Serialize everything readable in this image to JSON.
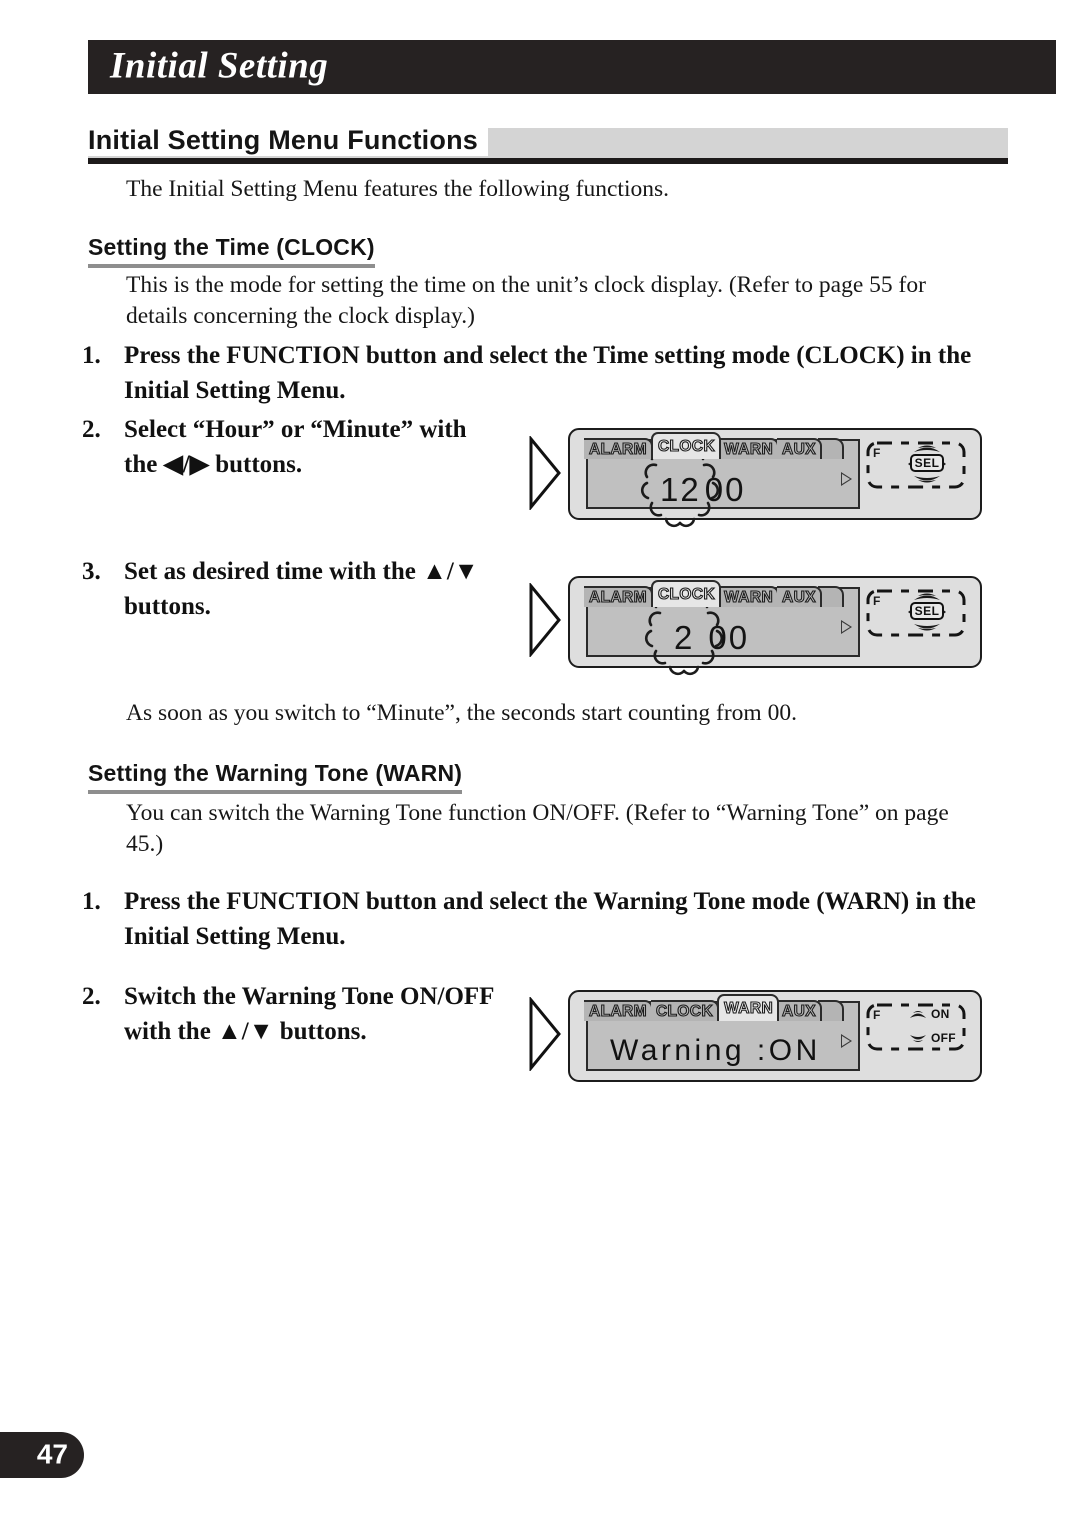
{
  "header": {
    "running_head": "Initial Setting"
  },
  "section": {
    "heading": "Initial Setting Menu Functions",
    "intro": "The Initial Setting Menu features the following functions."
  },
  "clock": {
    "subheading": "Setting the Time (CLOCK)",
    "description": "This is the mode for setting the time on the unit’s clock display. (Refer to page 55 for details concerning the clock display.)",
    "steps": [
      {
        "num": "1.",
        "text": "Press the FUNCTION button and select the Time setting mode (CLOCK) in the Initial Setting Menu."
      },
      {
        "num": "2.",
        "text": "Select “Hour” or “Minute” with the ◀/▶ buttons."
      },
      {
        "num": "3.",
        "text": "Set as desired time with the ▲/▼ buttons."
      }
    ],
    "note": "As soon as you switch to “Minute”, the seconds start counting from 00."
  },
  "warn": {
    "subheading": "Setting the Warning Tone (WARN)",
    "description": "You can switch the Warning Tone function ON/OFF. (Refer to “Warning Tone” on page 45.)",
    "steps": [
      {
        "num": "1.",
        "text": "Press the FUNCTION button and select the Warning Tone mode (WARN) in the Initial Setting Menu."
      },
      {
        "num": "2.",
        "text": "Switch the Warning Tone ON/OFF with the ▲/▼ buttons."
      }
    ]
  },
  "displays": [
    {
      "id": "clock-hour",
      "tabs": [
        "ALARM",
        "CLOCK",
        "WARN",
        "AUX"
      ],
      "active_tab": "CLOCK",
      "blinking_value": "12",
      "static_value": "00",
      "keys": {
        "func_label": "F",
        "select_label": "SEL"
      }
    },
    {
      "id": "clock-minute",
      "tabs": [
        "ALARM",
        "CLOCK",
        "WARN",
        "AUX"
      ],
      "active_tab": "CLOCK",
      "blinking_value": "2",
      "static_value": "00",
      "keys": {
        "func_label": "F",
        "select_label": "SEL"
      }
    },
    {
      "id": "warning-tone",
      "tabs": [
        "ALARM",
        "CLOCK",
        "WARN",
        "AUX"
      ],
      "active_tab": "WARN",
      "readout_text": "Warning  :ON",
      "keys": {
        "func_label": "F",
        "on_label": "ON",
        "off_label": "OFF"
      }
    }
  ],
  "footer": {
    "page_number": "47"
  },
  "colors": {
    "banner_bg": "#262222",
    "band_gray": "#d4d4d4",
    "rule_dark": "#1d1a1a",
    "subrule_gray": "#8e8e8e",
    "unit_body": "#dedede",
    "unit_screen": "#c0c0c0"
  }
}
